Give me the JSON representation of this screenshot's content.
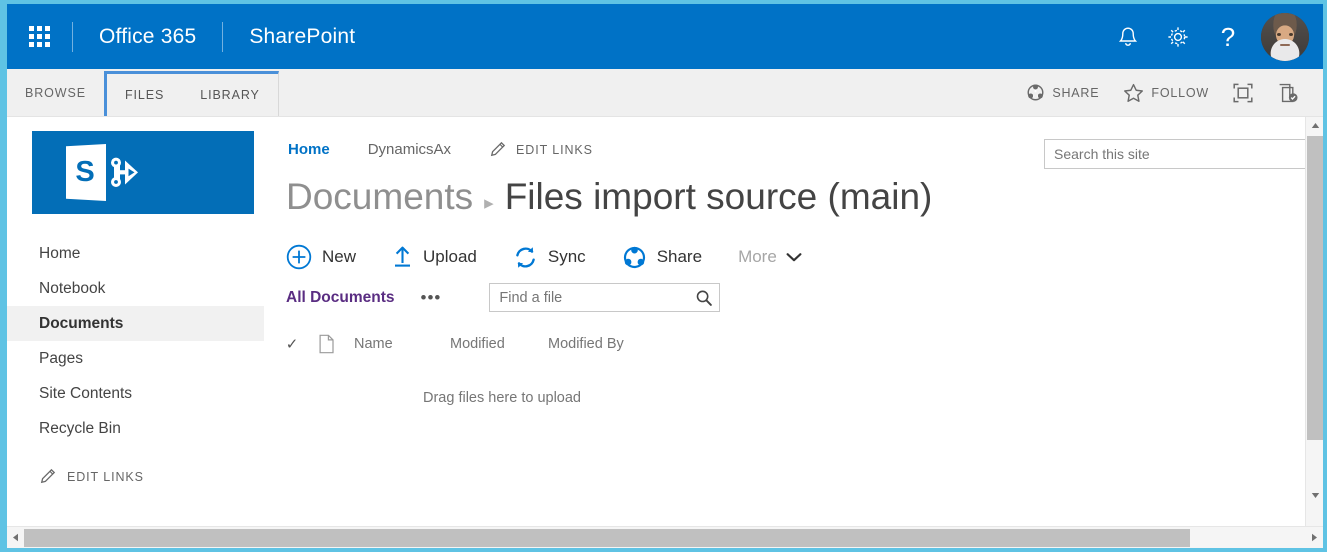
{
  "suitebar": {
    "waffle_label": "App launcher",
    "brand": "Office 365",
    "app": "SharePoint",
    "icons": [
      "notifications-icon",
      "settings-icon",
      "help-icon"
    ],
    "accent_color": "#0072c6"
  },
  "ribbon": {
    "tabs": [
      {
        "label": "BROWSE",
        "selected": false
      },
      {
        "label": "FILES",
        "selected": true
      },
      {
        "label": "LIBRARY",
        "selected": true
      }
    ],
    "actions": [
      {
        "label": "SHARE",
        "icon": "share-icon"
      },
      {
        "label": "FOLLOW",
        "icon": "star-icon"
      }
    ],
    "icon_buttons": [
      {
        "icon": "focus-on-content-icon"
      },
      {
        "icon": "sync-library-icon"
      }
    ]
  },
  "sidebar": {
    "logo_letter": "S",
    "items": [
      {
        "label": "Home",
        "selected": false
      },
      {
        "label": "Notebook",
        "selected": false
      },
      {
        "label": "Documents",
        "selected": true
      },
      {
        "label": "Pages",
        "selected": false
      },
      {
        "label": "Site Contents",
        "selected": false
      },
      {
        "label": "Recycle Bin",
        "selected": false
      }
    ],
    "edit_links": "EDIT LINKS"
  },
  "topnav": {
    "links": [
      {
        "label": "Home",
        "active": true
      },
      {
        "label": "DynamicsAx",
        "active": false
      }
    ],
    "edit_links": "EDIT LINKS"
  },
  "site_search": {
    "placeholder": "Search this site",
    "value": ""
  },
  "page_title": {
    "parent": "Documents",
    "separator": "▸",
    "current": "Files import source (main)"
  },
  "command_bar": {
    "commands": [
      {
        "label": "New",
        "icon": "plus-circle-icon"
      },
      {
        "label": "Upload",
        "icon": "upload-arrow-icon"
      },
      {
        "label": "Sync",
        "icon": "sync-icon"
      },
      {
        "label": "Share",
        "icon": "share-icon"
      }
    ],
    "more": "More",
    "accent_color": "#0072c6"
  },
  "view_bar": {
    "view_name": "All Documents",
    "ellipsis": "•••",
    "find_file": {
      "placeholder": "Find a file",
      "value": ""
    }
  },
  "list": {
    "columns": [
      {
        "label": "Name"
      },
      {
        "label": "Modified"
      },
      {
        "label": "Modified By"
      }
    ],
    "empty_message": "Drag files here to upload"
  },
  "scrollbars": {
    "vertical": {
      "position": "near-top"
    },
    "horizontal": {
      "position": "left"
    }
  }
}
